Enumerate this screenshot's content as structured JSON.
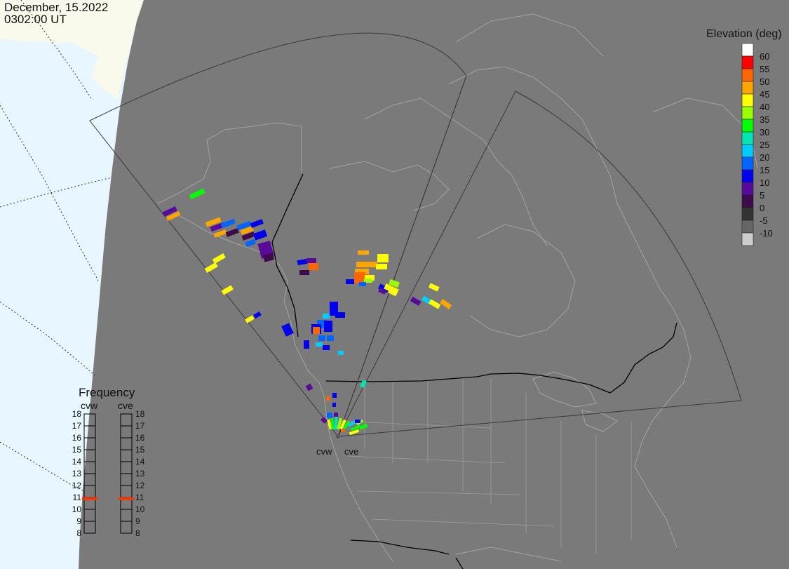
{
  "header": {
    "date": "December, 15.2022",
    "time": "0302:00 UT"
  },
  "colors": {
    "ocean": "#e8f6ff",
    "land_light": "#fafaec",
    "map_fill": "#7a7a7a",
    "coast": "#9c9c9c",
    "border": "#000000"
  },
  "elevation_scale": {
    "title": "Elevation (deg)",
    "bins": [
      {
        "label": "60",
        "color": "#ffffff"
      },
      {
        "label": "55",
        "color": "#ff0000"
      },
      {
        "label": "50",
        "color": "#ff6600"
      },
      {
        "label": "45",
        "color": "#ffa500"
      },
      {
        "label": "40",
        "color": "#ffff00"
      },
      {
        "label": "35",
        "color": "#99ff00"
      },
      {
        "label": "30",
        "color": "#00ff00"
      },
      {
        "label": "25",
        "color": "#00e6b3"
      },
      {
        "label": "20",
        "color": "#00ccff"
      },
      {
        "label": "15",
        "color": "#0066ff"
      },
      {
        "label": "10",
        "color": "#0000ee"
      },
      {
        "label": "5",
        "color": "#5a0a9a"
      },
      {
        "label": "0",
        "color": "#3d0a4a"
      },
      {
        "label": "-5",
        "color": "#333333"
      },
      {
        "label": "-10",
        "color": "#666666"
      },
      {
        "label": "",
        "color": "#cccccc"
      }
    ]
  },
  "frequency_panel": {
    "title": "Frequency",
    "radars": [
      {
        "name": "cvw",
        "frequency_mhz": 10.9
      },
      {
        "name": "cve",
        "frequency_mhz": 10.9
      }
    ],
    "ticks": [
      "18",
      "17",
      "16",
      "15",
      "14",
      "13",
      "12",
      "11",
      "10",
      "9",
      "8"
    ],
    "marker_color": "#ff3300"
  },
  "radar_sites": [
    {
      "name": "cvw"
    },
    {
      "name": "cve"
    }
  ]
}
